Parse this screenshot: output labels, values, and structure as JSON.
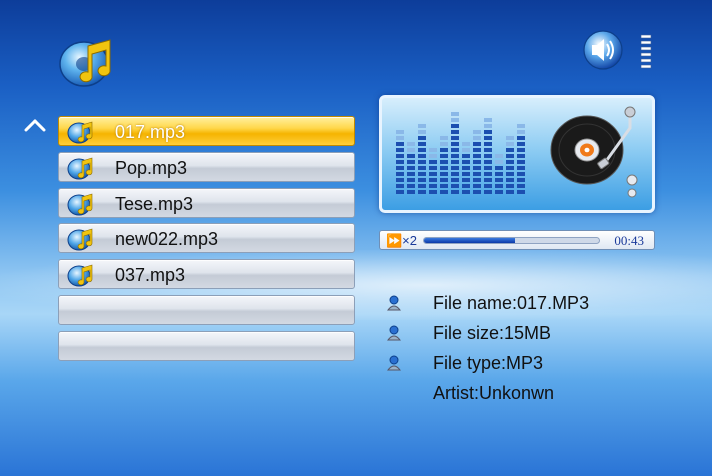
{
  "files": [
    {
      "name": "017.mp3",
      "selected": true
    },
    {
      "name": "Pop.mp3",
      "selected": false
    },
    {
      "name": "Tese.mp3",
      "selected": false
    },
    {
      "name": "new022.mp3",
      "selected": false
    },
    {
      "name": "037.mp3",
      "selected": false
    },
    {
      "name": "",
      "selected": false
    },
    {
      "name": "",
      "selected": false
    }
  ],
  "player": {
    "speed": "⏩×2",
    "time": "00:43",
    "progress_percent": 52
  },
  "info": {
    "file_name": "File name:017.MP3",
    "file_size": "File size:15MB",
    "file_type": "File type:MP3",
    "artist": "Artist:Unkonwn"
  },
  "icons": {
    "app": "music-note-disc-icon",
    "volume": "speaker-icon",
    "up": "chevron-up-icon",
    "file": "music-file-icon",
    "bullet": "person-bullet-icon"
  },
  "colors": {
    "selected": "#f5b400",
    "accent": "#1a3a9a"
  }
}
